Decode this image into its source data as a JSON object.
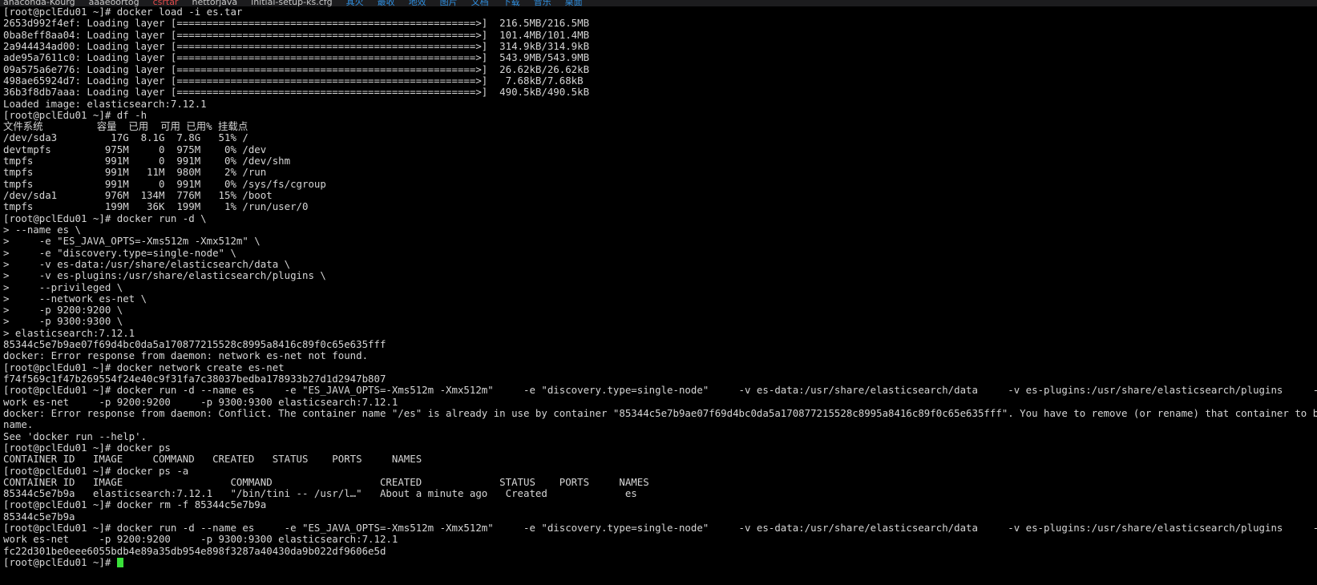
{
  "window": {
    "kind": "terminal-emulator",
    "background_color": "#000000",
    "foreground_color": "#d6d6d6",
    "cursor_color": "#3ae03a",
    "hostname_prompt": "[root@pclEdu01 ~]#"
  },
  "bookmark_bar": {
    "items": [
      {
        "label": "anaconda-Kourg",
        "color": "#c8c8c8"
      },
      {
        "label": "aaaeoortog",
        "color": "#c8c8c8"
      },
      {
        "label": "csrtar",
        "color": "#e04a4a"
      },
      {
        "label": "nettorjava",
        "color": "#c8c8c8"
      },
      {
        "label": "initial-setup-ks.cfg",
        "color": "#c8c8c8"
      },
      {
        "label": "其火",
        "color": "#2f8fe0"
      },
      {
        "label": "最收",
        "color": "#2f8fe0"
      },
      {
        "label": "地效",
        "color": "#2f8fe0"
      },
      {
        "label": "图片",
        "color": "#2f8fe0"
      },
      {
        "label": "文档",
        "color": "#2f8fe0"
      },
      {
        "label": "下载",
        "color": "#2f8fe0"
      },
      {
        "label": "音乐",
        "color": "#2f8fe0"
      },
      {
        "label": "桌面",
        "color": "#2f8fe0"
      }
    ]
  },
  "terminal_lines": [
    "[root@pclEdu01 ~]# docker load -i es.tar",
    "2653d992f4ef: Loading layer [==================================================>]  216.5MB/216.5MB",
    "0ba8eff8aa04: Loading layer [==================================================>]  101.4MB/101.4MB",
    "2a944434ad00: Loading layer [==================================================>]  314.9kB/314.9kB",
    "ade95a7611c0: Loading layer [==================================================>]  543.9MB/543.9MB",
    "09a575a6e776: Loading layer [==================================================>]  26.62kB/26.62kB",
    "498ae65924d7: Loading layer [==================================================>]   7.68kB/7.68kB",
    "36b3f8db7aaa: Loading layer [==================================================>]  490.5kB/490.5kB",
    "Loaded image: elasticsearch:7.12.1",
    "[root@pclEdu01 ~]# df -h",
    "文件系统         容量  已用  可用 已用% 挂载点",
    "/dev/sda3         17G  8.1G  7.8G   51% /",
    "devtmpfs         975M     0  975M    0% /dev",
    "tmpfs            991M     0  991M    0% /dev/shm",
    "tmpfs            991M   11M  980M    2% /run",
    "tmpfs            991M     0  991M    0% /sys/fs/cgroup",
    "/dev/sda1        976M  134M  776M   15% /boot",
    "tmpfs            199M   36K  199M    1% /run/user/0",
    "[root@pclEdu01 ~]# docker run -d \\",
    "> --name es \\",
    ">     -e \"ES_JAVA_OPTS=-Xms512m -Xmx512m\" \\",
    ">     -e \"discovery.type=single-node\" \\",
    ">     -v es-data:/usr/share/elasticsearch/data \\",
    ">     -v es-plugins:/usr/share/elasticsearch/plugins \\",
    ">     --privileged \\",
    ">     --network es-net \\",
    ">     -p 9200:9200 \\",
    ">     -p 9300:9300 \\",
    "> elasticsearch:7.12.1",
    "85344c5e7b9ae07f69d4bc0da5a170877215528c8995a8416c89f0c65e635fff",
    "docker: Error response from daemon: network es-net not found.",
    "[root@pclEdu01 ~]# docker network create es-net",
    "f74f569c1f47b269554f24e40c9f31fa7c38037bedba178933b27d1d2947b807",
    "[root@pclEdu01 ~]# docker run -d --name es     -e \"ES_JAVA_OPTS=-Xms512m -Xmx512m\"     -e \"discovery.type=single-node\"     -v es-data:/usr/share/elasticsearch/data     -v es-plugins:/usr/share/elasticsearch/plugins     --privileged     --net",
    "work es-net     -p 9200:9200     -p 9300:9300 elasticsearch:7.12.1",
    "docker: Error response from daemon: Conflict. The container name \"/es\" is already in use by container \"85344c5e7b9ae07f69d4bc0da5a170877215528c8995a8416c89f0c65e635fff\". You have to remove (or rename) that container to be able to reus",
    "name.",
    "See 'docker run --help'.",
    "[root@pclEdu01 ~]# docker ps",
    "CONTAINER ID   IMAGE     COMMAND   CREATED   STATUS    PORTS     NAMES",
    "[root@pclEdu01 ~]# docker ps -a",
    "CONTAINER ID   IMAGE                  COMMAND                  CREATED             STATUS    PORTS     NAMES",
    "85344c5e7b9a   elasticsearch:7.12.1   \"/bin/tini -- /usr/l…\"   About a minute ago   Created             es",
    "[root@pclEdu01 ~]# docker rm -f 85344c5e7b9a",
    "85344c5e7b9a",
    "[root@pclEdu01 ~]# docker run -d --name es     -e \"ES_JAVA_OPTS=-Xms512m -Xmx512m\"     -e \"discovery.type=single-node\"     -v es-data:/usr/share/elasticsearch/data     -v es-plugins:/usr/share/elasticsearch/plugins     --privileged     --net",
    "work es-net     -p 9200:9200     -p 9300:9300 elasticsearch:7.12.1",
    "fc22d301be0eee6055bdb4e89a35db954e898f3287a40430da9b022df9606e5d"
  ],
  "prompt_line": {
    "text": "[root@pclEdu01 ~]# ",
    "cursor": "block"
  }
}
